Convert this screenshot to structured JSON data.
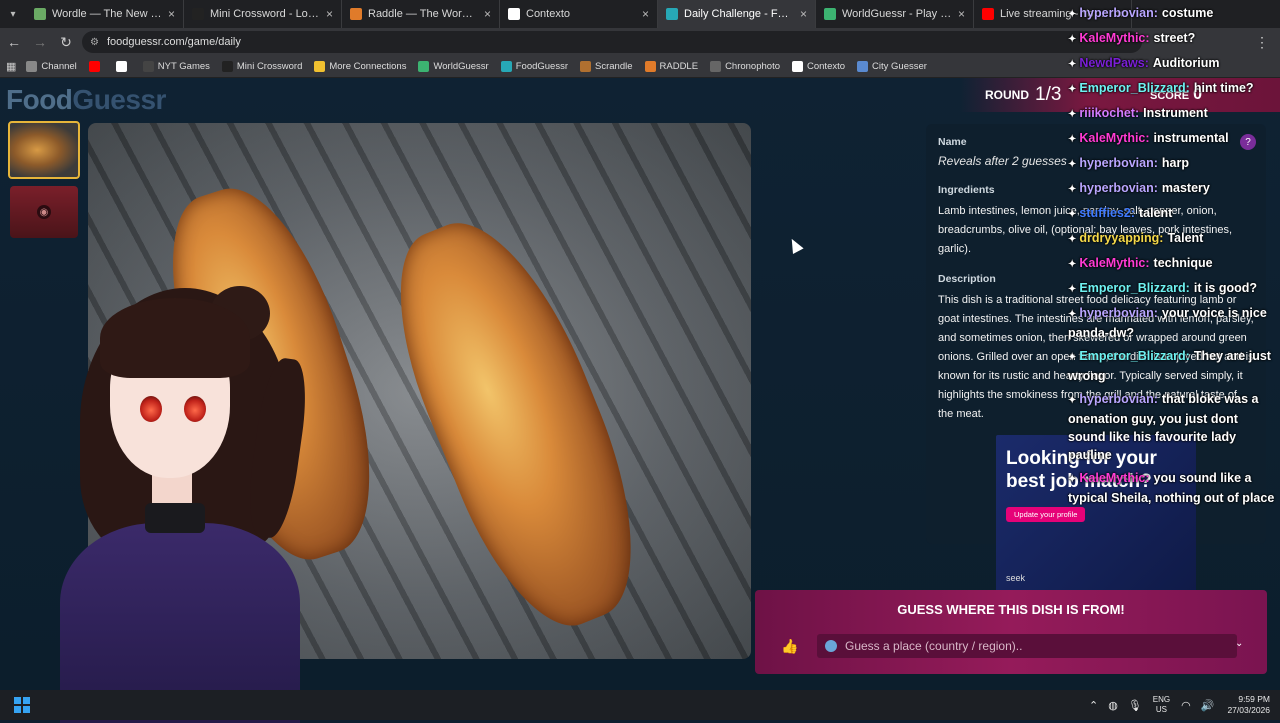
{
  "tabs": [
    {
      "label": "Wordle — The New York Times",
      "color": "#6aaa64",
      "active": false
    },
    {
      "label": "Mini Crossword - Los Angeles T",
      "color": "#222222",
      "active": false
    },
    {
      "label": "Raddle — The Word Transform",
      "color": "#e07b2a",
      "active": false
    },
    {
      "label": "Contexto",
      "color": "#ffffff",
      "active": false
    },
    {
      "label": "Daily Challenge - FoodGuessr",
      "color": "#27a8b6",
      "active": true
    },
    {
      "label": "WorldGuessr - Play Geoguessr",
      "color": "#3cb371",
      "active": false
    },
    {
      "label": "Live streaming - YouTube",
      "color": "#ff0000",
      "active": false
    }
  ],
  "address": {
    "url": "foodguessr.com/game/daily"
  },
  "bookmarks": [
    {
      "label": "Channel",
      "color": "#888888"
    },
    {
      "label": "",
      "color": "#ff0000"
    },
    {
      "label": "",
      "color": "#ffffff"
    },
    {
      "label": "NYT Games",
      "color": "#444444"
    },
    {
      "label": "Mini Crossword",
      "color": "#222222"
    },
    {
      "label": "More Connections",
      "color": "#f0c030"
    },
    {
      "label": "WorldGuessr",
      "color": "#3cb371"
    },
    {
      "label": "FoodGuessr",
      "color": "#27a8b6"
    },
    {
      "label": "Scrandle",
      "color": "#b07030"
    },
    {
      "label": "RADDLE",
      "color": "#e07b2a"
    },
    {
      "label": "Chronophoto",
      "color": "#666666"
    },
    {
      "label": "Contexto",
      "color": "#ffffff"
    },
    {
      "label": "City Guesser",
      "color": "#5a8ad0"
    }
  ],
  "logo": {
    "food": "Food",
    "guessr": "Guessr"
  },
  "round": {
    "label": "ROUND",
    "value": "1/3"
  },
  "score": {
    "label": "SCORE",
    "value": "0"
  },
  "info": {
    "name_label": "Name",
    "name_value": "Reveals after 2 guesses",
    "ingredients_label": "Ingredients",
    "ingredients": "Lamb intestines, lemon juice, parsley, salt, pepper, onion, breadcrumbs, olive oil, (optional: bay leaves, pork intestines, garlic).",
    "description_label": "Description",
    "description": "This dish is a traditional street food delicacy featuring lamb or goat intestines. The intestines are marinated with lemon, parsley, and sometimes onion, then skewered or wrapped around green onions. Grilled over an open flame, the dish is enjoyed hot and is known for its rustic and hearty flavor. Typically served simply, it highlights the smokiness from the grill and the natural taste of the meat."
  },
  "ad": {
    "headline": "Looking for your best job match?",
    "button": "Update your profile",
    "brand": "seek"
  },
  "guess": {
    "title": "GUESS WHERE THIS DISH IS FROM!",
    "placeholder": "Guess a place (country / region).."
  },
  "chat": [
    {
      "user": "hyperbovian:",
      "text": "costume",
      "color": "#b9a6ff"
    },
    {
      "user": "KaleMythic:",
      "text": "street?",
      "color": "#ff3bd4"
    },
    {
      "user": "NewdPaws:",
      "text": "Auditorium",
      "color": "#7a1fd6"
    },
    {
      "user": "Emperor_Blizzard:",
      "text": "hint time?",
      "color": "#6ef2f2"
    },
    {
      "user": "riiikochet:",
      "text": "Instrument",
      "color": "#d27cff"
    },
    {
      "user": "KaleMythic:",
      "text": "instrumental",
      "color": "#ff3bd4"
    },
    {
      "user": "hyperbovian:",
      "text": "harp",
      "color": "#b9a6ff"
    },
    {
      "user": "hyperbovian:",
      "text": "mastery",
      "color": "#b9a6ff"
    },
    {
      "user": "stuffies2:",
      "text": "talent",
      "color": "#3f7bff"
    },
    {
      "user": "drdryyapping:",
      "text": "Talent",
      "color": "#f5d94a"
    },
    {
      "user": "KaleMythic:",
      "text": "technique",
      "color": "#ff3bd4"
    },
    {
      "user": "Emperor_Blizzard:",
      "text": "it is good?",
      "color": "#6ef2f2"
    },
    {
      "user": "hyperbovian:",
      "text": "your voice is nice panda-dw?",
      "color": "#b9a6ff"
    },
    {
      "user": "Emperor_Blizzard:",
      "text": "They are just wrong",
      "color": "#6ef2f2"
    },
    {
      "user": "hyperbovian:",
      "text": "that bloke was a onenation guy, you just dont sound like his favourite lady pauline",
      "color": "#b9a6ff"
    },
    {
      "user": "KaleMythic:",
      "text": "you sound like a typical Sheila, nothing out of place",
      "color": "#ff3bd4"
    }
  ],
  "taskbar": {
    "lang_top": "ENG",
    "lang_bottom": "US",
    "time": "9:59 PM",
    "date": "27/03/2026"
  }
}
